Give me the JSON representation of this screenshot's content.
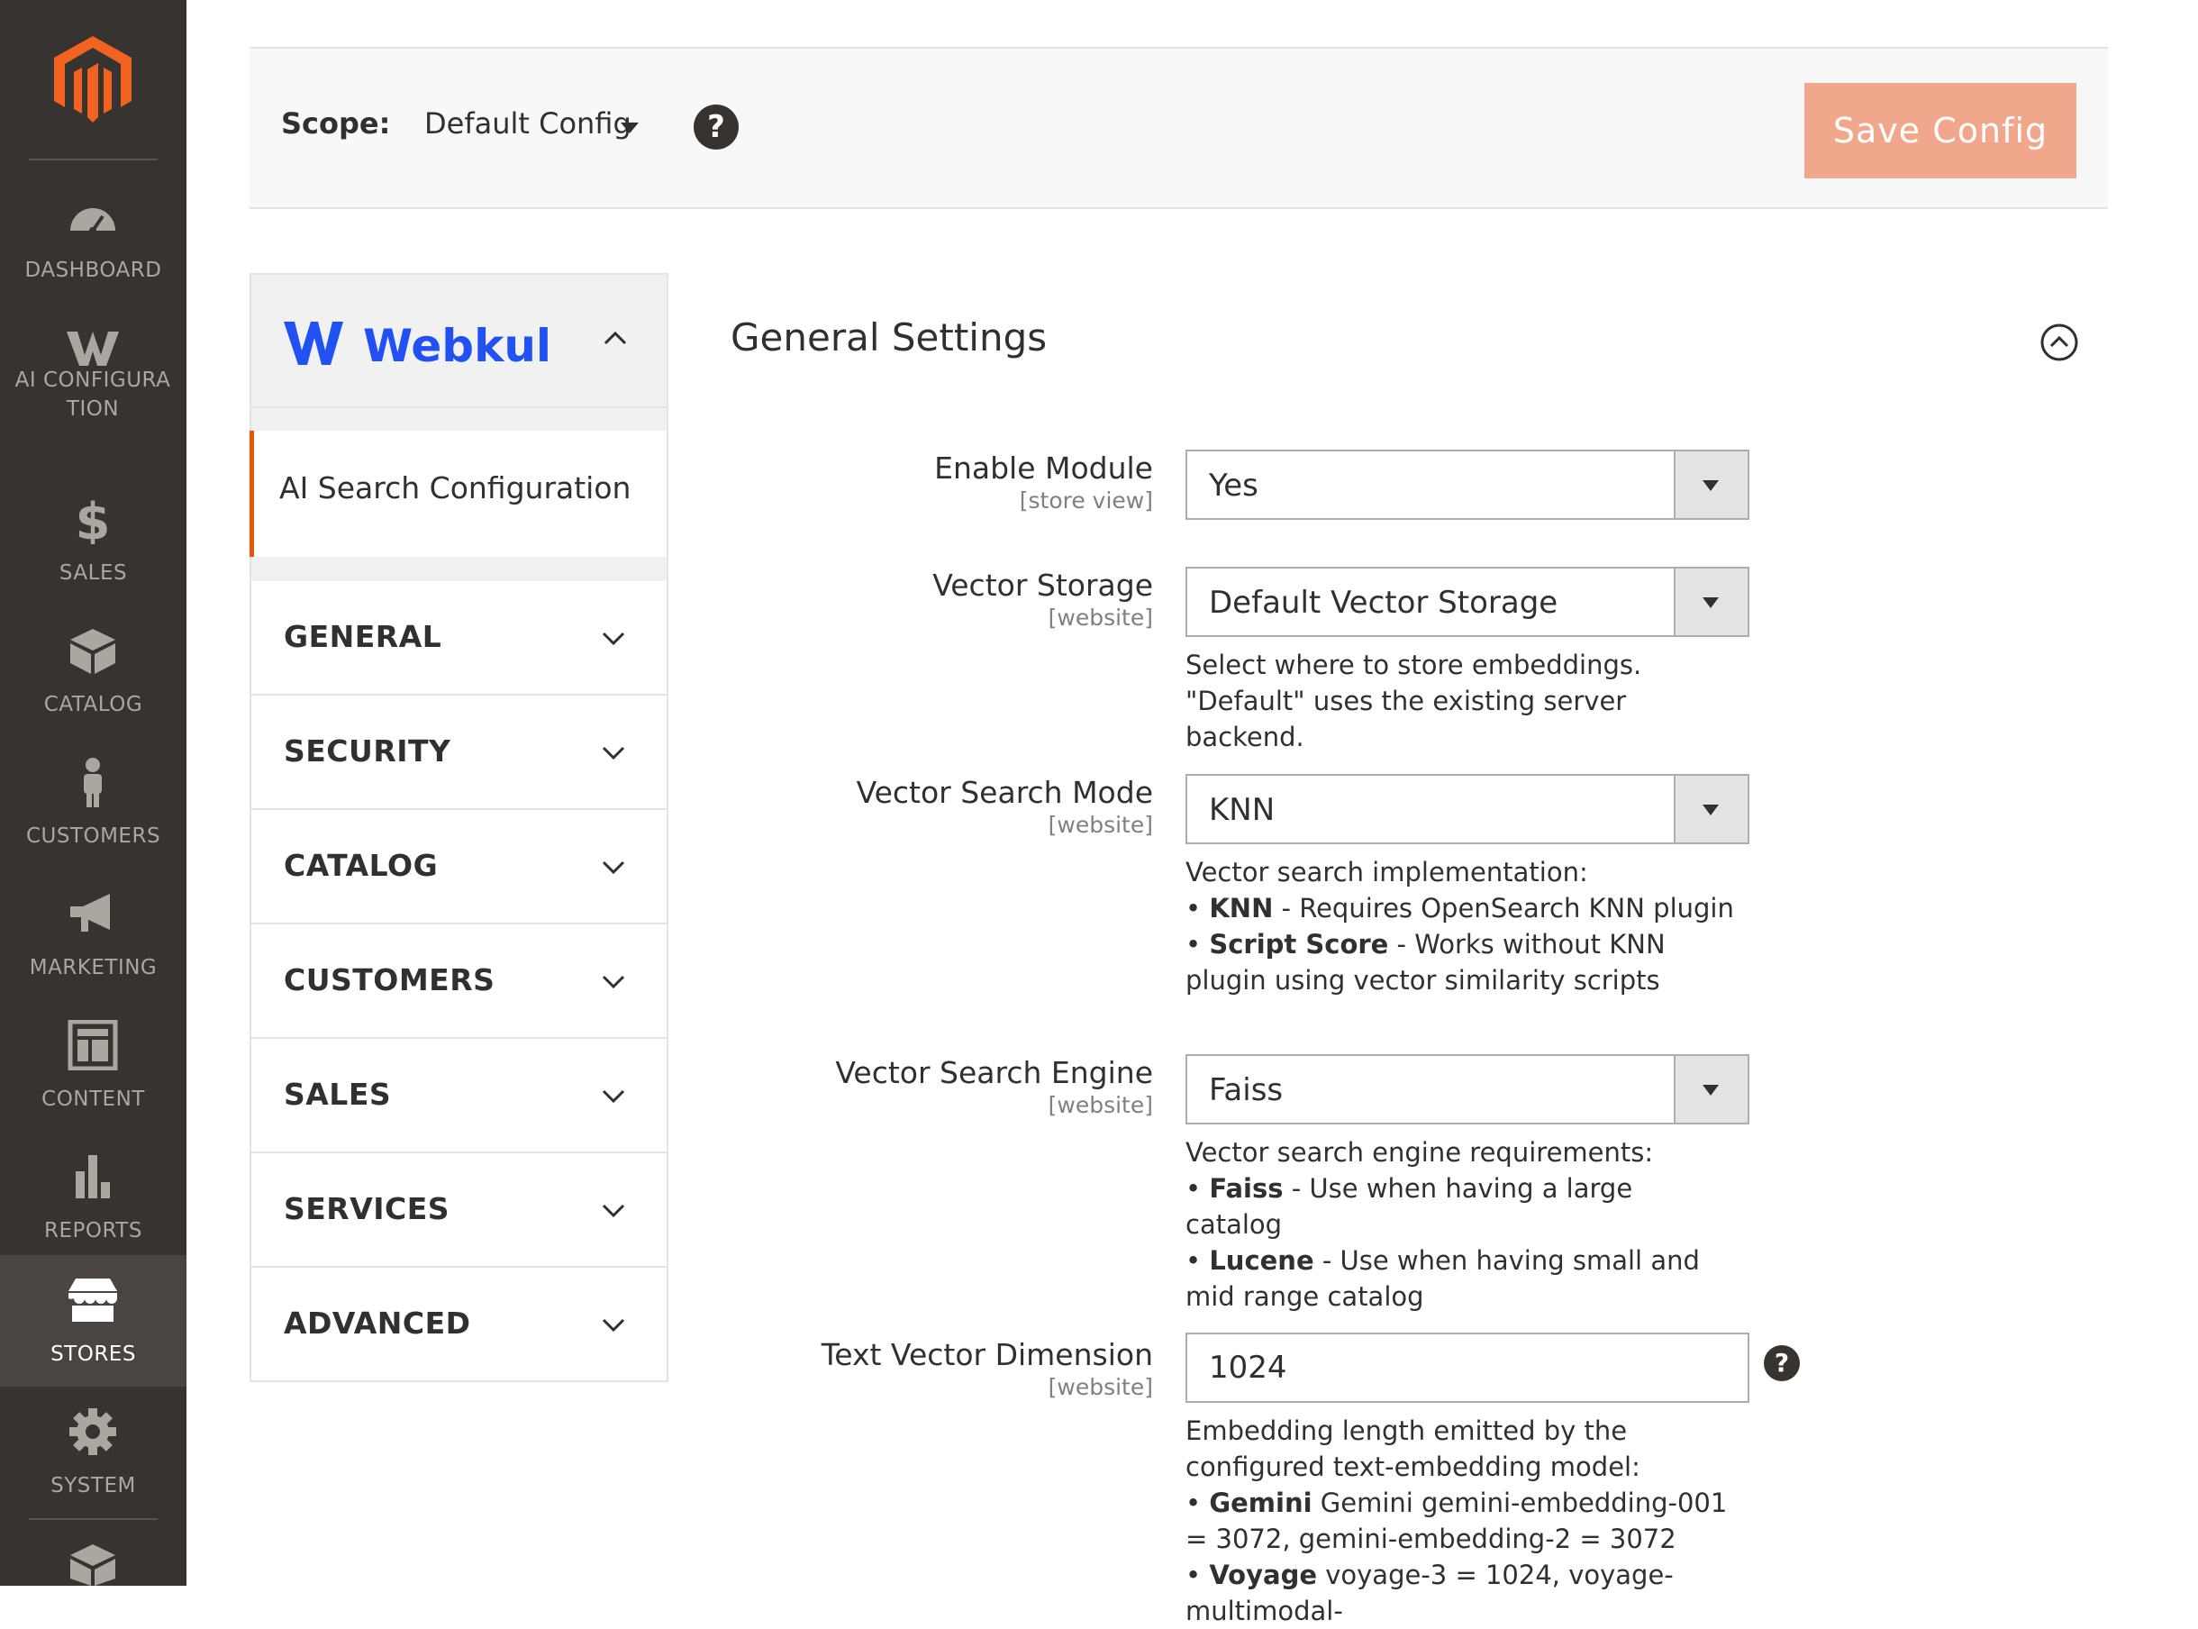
{
  "admin_nav": {
    "items": [
      {
        "label": "DASHBOARD",
        "icon": "dashboard-icon"
      },
      {
        "label": "AI CONFIGURATION",
        "icon": "webkul-w-icon"
      },
      {
        "label": "SALES",
        "icon": "dollar-icon"
      },
      {
        "label": "CATALOG",
        "icon": "box-icon"
      },
      {
        "label": "CUSTOMERS",
        "icon": "person-icon"
      },
      {
        "label": "MARKETING",
        "icon": "megaphone-icon"
      },
      {
        "label": "CONTENT",
        "icon": "layout-icon"
      },
      {
        "label": "REPORTS",
        "icon": "bar-chart-icon"
      },
      {
        "label": "STORES",
        "icon": "store-icon"
      },
      {
        "label": "SYSTEM",
        "icon": "gear-icon"
      }
    ],
    "active": "STORES"
  },
  "scope": {
    "label": "Scope:",
    "value": "Default Config",
    "help": "?"
  },
  "save_button": "Save Config",
  "config_tabs": {
    "vendor": "Webkul",
    "vendor_item": "AI Search Configuration",
    "sections": [
      "GENERAL",
      "SECURITY",
      "CATALOG",
      "CUSTOMERS",
      "SALES",
      "SERVICES",
      "ADVANCED"
    ]
  },
  "form": {
    "title": "General Settings",
    "enable_module": {
      "label": "Enable Module",
      "scope": "[store view]",
      "value": "Yes"
    },
    "vector_storage": {
      "label": "Vector Storage",
      "scope": "[website]",
      "value": "Default Vector Storage",
      "note": "Select where to store embeddings. \"Default\" uses the existing server backend."
    },
    "vector_search_mode": {
      "label": "Vector Search Mode",
      "scope": "[website]",
      "value": "KNN",
      "note_intro": "Vector search implementation:",
      "note_b1_key": "KNN",
      "note_b1_text": " - Requires OpenSearch KNN plugin",
      "note_b2_key": "Script Score",
      "note_b2_text": " - Works without KNN plugin using vector similarity scripts"
    },
    "vector_search_engine": {
      "label": "Vector Search Engine",
      "scope": "[website]",
      "value": "Faiss",
      "note_intro": "Vector search engine requirements:",
      "note_b1_key": "Faiss",
      "note_b1_text": " - Use when having a large catalog",
      "note_b2_key": "Lucene",
      "note_b2_text": " - Use when having small and mid range catalog"
    },
    "text_vector_dimension": {
      "label": "Text Vector Dimension",
      "scope": "[website]",
      "value": "1024",
      "help": "?",
      "note_intro": "Embedding length emitted by the configured text-embedding model:",
      "note_b1_key": "Gemini",
      "note_b1_text": " Gemini gemini-embedding-001 = 3072, gemini-embedding-2 = 3072",
      "note_b2_key": "Voyage",
      "note_b2_text": " voyage-3 = 1024, voyage-multimodal-"
    }
  }
}
